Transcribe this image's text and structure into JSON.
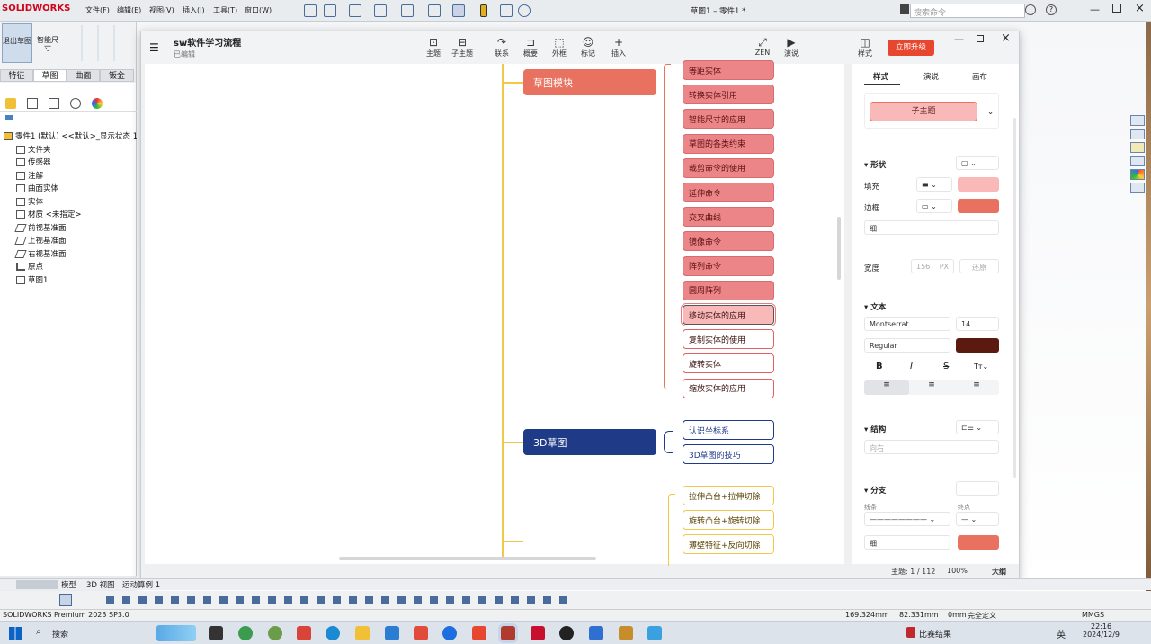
{
  "sw": {
    "brand": "SOLIDWORKS",
    "menus": [
      "文件(F)",
      "编辑(E)",
      "视图(V)",
      "插入(I)",
      "工具(T)",
      "窗口(W)"
    ],
    "title": "草图1 – 零件1 *",
    "search_placeholder": "搜索命令",
    "cmd_exit_sketch": "退出草图",
    "cmd_smart_dim": "智能尺寸",
    "cmd_tabs": [
      "特征",
      "草图",
      "曲面",
      "钣金"
    ],
    "tree_root": "零件1 (默认) <<默认>_显示状态 1>",
    "tree_items": [
      "文件夹",
      "传感器",
      "注解",
      "曲面实体",
      "实体",
      "材质 <未指定>",
      "前视基准面",
      "上视基准面",
      "右视基准面",
      "原点",
      "草图1"
    ],
    "bottom_tabs": [
      "模型",
      "3D 视图",
      "运动算例 1"
    ],
    "status_left": "SOLIDWORKS Premium 2023 SP3.0",
    "status_x": "169.324mm",
    "status_y": "82.331mm",
    "status_z": "0mm",
    "status_state": "完全定义",
    "status_units": "MMGS"
  },
  "xmind": {
    "doc_title": "sw软件学习流程",
    "doc_status": "已编辑",
    "upgrade_button": "立即升级",
    "toolbar": [
      "主题",
      "子主题",
      "联系",
      "概要",
      "外框",
      "标记",
      "插入"
    ],
    "toolbar_right": [
      "ZEN",
      "演说"
    ],
    "format_label": "样式",
    "branch_sketch": "草图模块",
    "branch_3d": "3D草图",
    "sketch_children_filled": [
      "等距实体",
      "转换实体引用",
      "智能尺寸的应用",
      "草图的各类约束",
      "裁剪命令的使用",
      "延伸命令",
      "交叉曲线",
      "镜像命令",
      "阵列命令",
      "圆周阵列"
    ],
    "sketch_selected": "移动实体的应用",
    "sketch_children_outlined": [
      "复制实体的使用",
      "旋转实体",
      "缩放实体的应用"
    ],
    "children_3d": [
      "认识坐标系",
      "3D草图的技巧"
    ],
    "children_feature": [
      "拉伸凸台+拉伸切除",
      "旋转凸台+旋转切除",
      "薄壁特征+反向切除"
    ],
    "panel_tabs": [
      "样式",
      "演说",
      "画布"
    ],
    "style_name": "子主题",
    "sec_shape": "形状",
    "fill_label": "填充",
    "border_label": "边框",
    "border_weight": "细",
    "width_label": "宽度",
    "width_value": "156",
    "width_unit": "PX",
    "width_reset": "还原",
    "sec_text": "文本",
    "font_family": "Montserrat",
    "font_size": "14",
    "font_weight": "Regular",
    "sec_structure": "结构",
    "structure_value": "向右",
    "sec_branch": "分支",
    "line_label": "线条",
    "end_label": "终点",
    "branch_weight": "细",
    "status_topics": "主题: 1 / 112",
    "zoom": "100%",
    "outline": "大纲",
    "colors": {
      "fill": "#f9b9b9",
      "border": "#e8725f",
      "text": "#5a1a10",
      "upgrade": "#e8472f",
      "branch_filled": "#ec8588",
      "branch_head": "#e8725f",
      "navy": "#1f3a87",
      "yellow": "#f2c84b"
    }
  },
  "taskbar": {
    "search": "搜索",
    "weather": "比赛结果",
    "ime": "英",
    "time": "22:16",
    "date": "2024/12/9"
  }
}
